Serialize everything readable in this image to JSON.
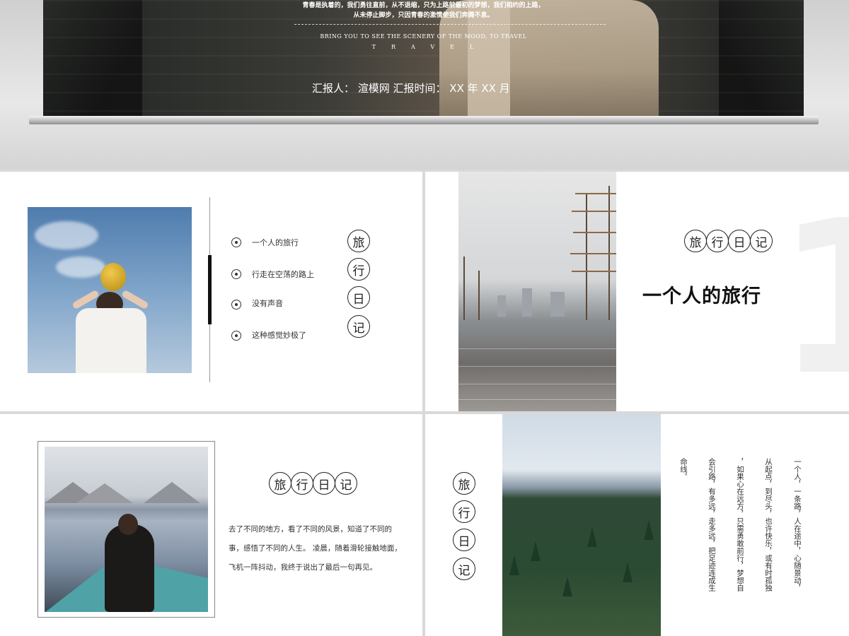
{
  "cover": {
    "line1": "青春是执着的，我们勇往直前，从不退缩，只为上路前最初的梦想，我们相约的上路，",
    "line2": "从未停止脚步，只因青春的激情使我们奔腾不息。",
    "line3": "BRING YOU TO SEE THE SCENERY OF THE MOOD, TO TRAVEL",
    "line4": "TRAVEL",
    "reporter": "汇报人：  渲模网    汇报时间：  XX 年 XX 月"
  },
  "slide1": {
    "bullets": [
      "一个人的旅行",
      "行走在空荡的路上",
      "没有声音",
      "这种感觉妙极了"
    ],
    "title_chars": [
      "旅",
      "行",
      "日",
      "记"
    ]
  },
  "slide2": {
    "title_chars": [
      "旅",
      "行",
      "日",
      "记"
    ],
    "headline": "一个人的旅行",
    "big_number": "1"
  },
  "slide3": {
    "title_chars": [
      "旅",
      "行",
      "日",
      "记"
    ],
    "paragraph": "去了不同的地方，看了不同的风景，知道了不同的事，感悟了不同的人生。 凌晨，随着滑轮接触地面，飞机一阵抖动，我终于说出了最后一句再见。"
  },
  "slide4": {
    "title_chars": [
      "旅",
      "行",
      "日",
      "记"
    ],
    "columns": [
      "一个人，一条路，人在途中，心随景动，",
      "从起点，到尽头，也许快乐，或有时孤独",
      "，如果心在远方，只需勇敢前行，梦想自",
      "会引路，有多远，走多远，把足迹连成生",
      "命线。"
    ]
  }
}
